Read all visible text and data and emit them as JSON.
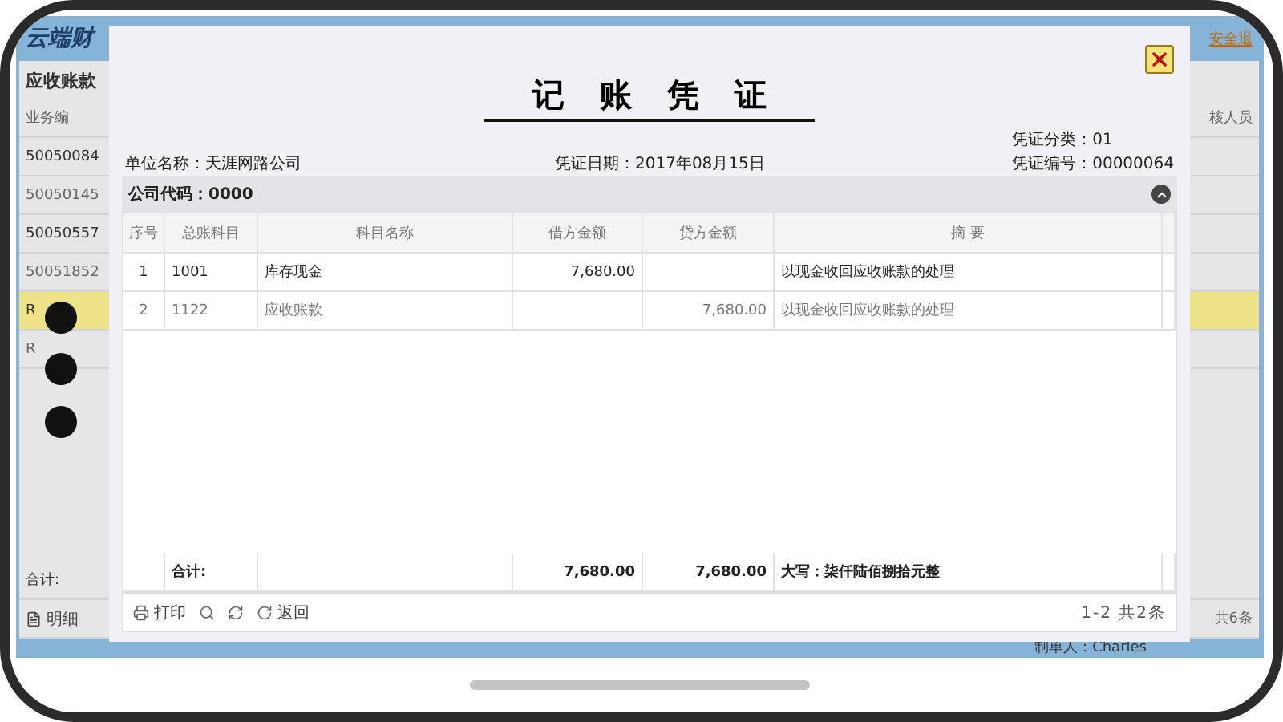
{
  "background_app": {
    "title": "云端财",
    "panel_title": "应收账款",
    "column_header": "业务编",
    "right_column_header": "核人员",
    "logout_link": "安全退",
    "rows": [
      {
        "text": "50050084",
        "selected": false
      },
      {
        "text": "50050145",
        "selected": false
      },
      {
        "text": "50050557",
        "selected": false
      },
      {
        "text": "50051852",
        "selected": false
      },
      {
        "text": "R",
        "selected": true
      },
      {
        "text": "R",
        "selected": false
      }
    ],
    "total_label": "合计:",
    "detail_button": "明细",
    "record_count": "共6条",
    "creator": "制单人：Charles"
  },
  "voucher": {
    "title": "记账凭证",
    "unit_name": "单位名称：天涯网路公司",
    "date": "凭证日期：2017年08月15日",
    "category": "凭证分类：01",
    "number": "凭证编号：00000064",
    "company_code": "公司代码：0000",
    "columns": [
      "序号",
      "总账科目",
      "科目名称",
      "借方金额",
      "贷方金额",
      "摘 要"
    ],
    "rows": [
      {
        "seq": "1",
        "account_code": "1001",
        "account_name": "库存现金",
        "debit": "7,680.00",
        "summary": "以现金收回应收账款的处理"
      },
      {
        "seq": "2",
        "account_code": "1122",
        "account_name": "应收账款",
        "credit": "7,680.00",
        "summary": "以现金收回应收账款的处理"
      }
    ],
    "totals": {
      "label": "合计:",
      "debit": "7,680.00",
      "credit": "7,680.00",
      "in_words": "大写：柒仟陆佰捌拾元整"
    },
    "toolbar": [
      {
        "kind": "print",
        "label": "打印"
      },
      {
        "kind": "search"
      },
      {
        "kind": "refresh"
      },
      {
        "kind": "back",
        "label": "返回"
      }
    ],
    "pagination": "1-2 共2条"
  }
}
